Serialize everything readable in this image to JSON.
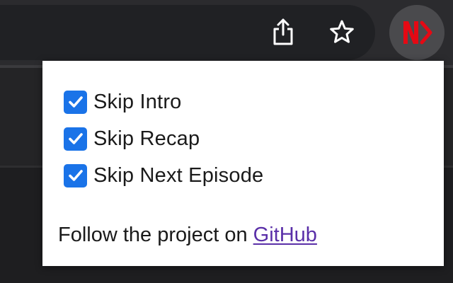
{
  "toolbar": {
    "share_icon": "share-icon",
    "star_icon": "star-icon",
    "extension_icon": "netflix-skipper-extension-icon",
    "extension_logo_text": "N"
  },
  "popup": {
    "options": [
      {
        "label": "Skip Intro",
        "checked": true
      },
      {
        "label": "Skip Recap",
        "checked": true
      },
      {
        "label": "Skip Next Episode",
        "checked": true
      }
    ],
    "footer_text": "Follow the project on ",
    "footer_link": "GitHub"
  },
  "colors": {
    "checkbox_accent": "#1a73e8",
    "link": "#5a2fa8",
    "logo_red": "#e50914",
    "toolbar_bg": "#2b2b2e"
  }
}
